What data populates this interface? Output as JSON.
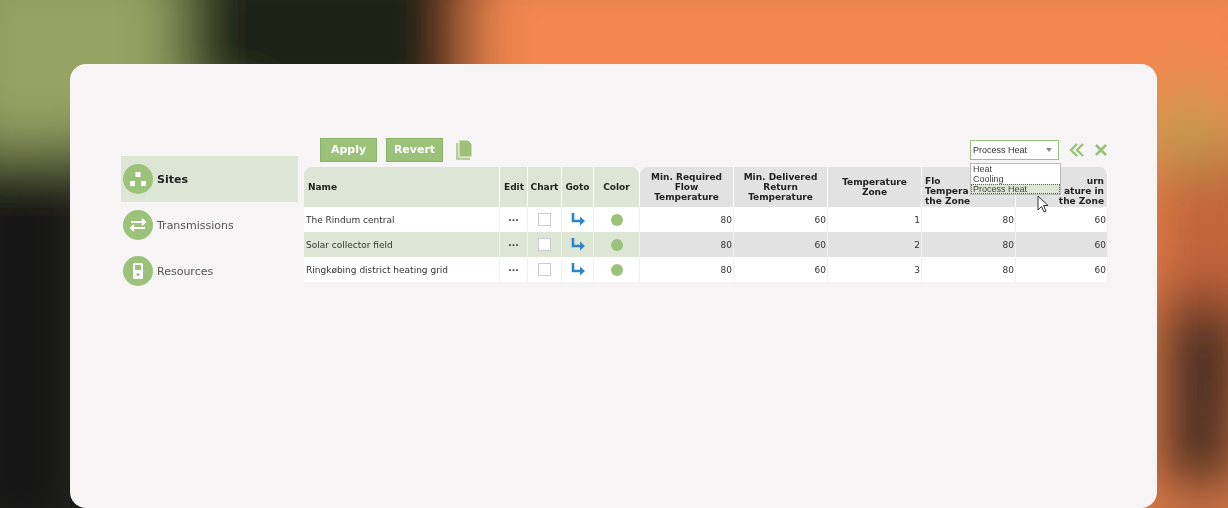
{
  "sidebar": {
    "items": [
      {
        "label": "Sites",
        "kind": "sites",
        "selected": true
      },
      {
        "label": "Transmissions",
        "kind": "transmissions",
        "selected": false
      },
      {
        "label": "Resources",
        "kind": "resources",
        "selected": false
      }
    ]
  },
  "toolbar": {
    "buttons": [
      "Apply",
      "Revert"
    ],
    "select": {
      "value": "Process Heat",
      "expanded": true,
      "options": [
        {
          "label": "Heat",
          "selected": false
        },
        {
          "label": "Cooling",
          "selected": false
        },
        {
          "label": "Process Heat",
          "selected": true
        }
      ]
    }
  },
  "table": {
    "columns": [
      {
        "lines": [
          "Name"
        ],
        "kind": "name"
      },
      {
        "lines": [
          "Edit"
        ],
        "kind": "action"
      },
      {
        "lines": [
          "Chart"
        ],
        "kind": "action"
      },
      {
        "lines": [
          "Goto"
        ],
        "kind": "action"
      },
      {
        "lines": [
          "Color"
        ],
        "kind": "action"
      },
      {
        "lines": [
          "Min. Required",
          "Flow",
          "Temperature"
        ],
        "kind": "value"
      },
      {
        "lines": [
          "Min. Delivered",
          "Return",
          "Temperature"
        ],
        "kind": "value"
      },
      {
        "lines": [
          "Temperature",
          "Zone"
        ],
        "kind": "value"
      },
      {
        "lines": [
          "Flo",
          "Tempera",
          "the Zone"
        ],
        "kind": "cutright"
      },
      {
        "lines": [
          "urn",
          "ature in",
          "the Zone"
        ],
        "kind": "cutleft"
      }
    ],
    "rows": [
      {
        "name": "The Rindum central",
        "edit": "···",
        "chart": false,
        "color": "#9cc27a",
        "values": [
          "80",
          "60",
          "1",
          "80",
          "60"
        ],
        "selected": false
      },
      {
        "name": "Solar collector field",
        "edit": "···",
        "chart": false,
        "color": "#9cc27a",
        "values": [
          "80",
          "60",
          "2",
          "80",
          "60"
        ],
        "selected": true
      },
      {
        "name": "Ringkøbing district heating grid",
        "edit": "···",
        "chart": false,
        "color": "#9cc27a",
        "values": [
          "80",
          "60",
          "3",
          "80",
          "60"
        ],
        "selected": false
      }
    ]
  }
}
